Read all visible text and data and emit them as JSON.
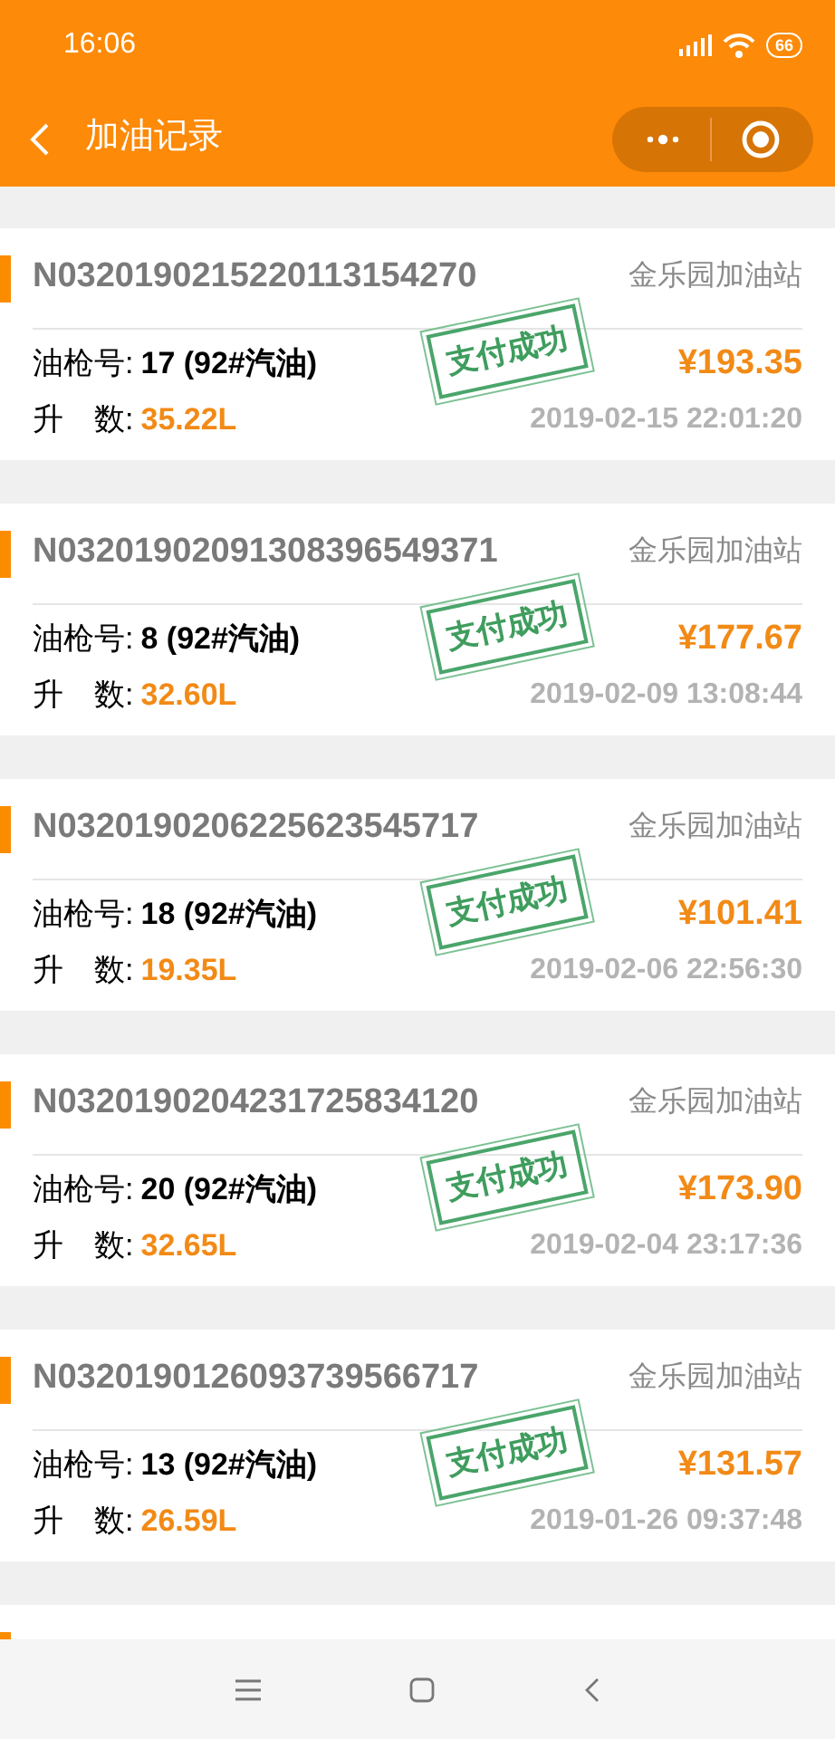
{
  "status_bar": {
    "time": "16:06",
    "battery": "66"
  },
  "header": {
    "title": "加油记录"
  },
  "records": [
    {
      "order_no": "N0320190215220113154270",
      "station": "金乐园加油站",
      "pump_label": "油枪号:",
      "pump": "17 (92#汽油)",
      "volume_label": "升　数:",
      "volume": "35.22L",
      "amount": "¥193.35",
      "time": "2019-02-15 22:01:20",
      "stamp": "支付成功"
    },
    {
      "order_no": "N03201902091308396549371",
      "station": "金乐园加油站",
      "pump_label": "油枪号:",
      "pump": "8 (92#汽油)",
      "volume_label": "升　数:",
      "volume": "32.60L",
      "amount": "¥177.67",
      "time": "2019-02-09 13:08:44",
      "stamp": "支付成功"
    },
    {
      "order_no": "N0320190206225623545717",
      "station": "金乐园加油站",
      "pump_label": "油枪号:",
      "pump": "18 (92#汽油)",
      "volume_label": "升　数:",
      "volume": "19.35L",
      "amount": "¥101.41",
      "time": "2019-02-06 22:56:30",
      "stamp": "支付成功"
    },
    {
      "order_no": "N0320190204231725834120",
      "station": "金乐园加油站",
      "pump_label": "油枪号:",
      "pump": "20 (92#汽油)",
      "volume_label": "升　数:",
      "volume": "32.65L",
      "amount": "¥173.90",
      "time": "2019-02-04 23:17:36",
      "stamp": "支付成功"
    },
    {
      "order_no": "N0320190126093739566717",
      "station": "金乐园加油站",
      "pump_label": "油枪号:",
      "pump": "13 (92#汽油)",
      "volume_label": "升　数:",
      "volume": "26.59L",
      "amount": "¥131.57",
      "time": "2019-01-26 09:37:48",
      "stamp": "支付成功"
    }
  ]
}
